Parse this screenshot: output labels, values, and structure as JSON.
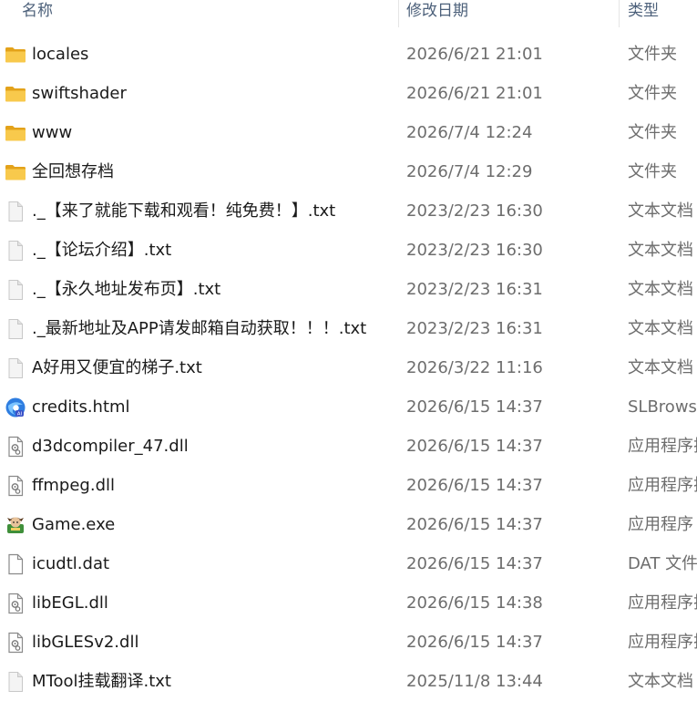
{
  "header": {
    "name": "名称",
    "date": "修改日期",
    "type": "类型"
  },
  "files": [
    {
      "name": "locales",
      "date": "2026/6/21 21:01",
      "type": "文件夹",
      "icon": "folder-icon"
    },
    {
      "name": "swiftshader",
      "date": "2026/6/21 21:01",
      "type": "文件夹",
      "icon": "folder-icon"
    },
    {
      "name": "www",
      "date": "2026/7/4 12:24",
      "type": "文件夹",
      "icon": "folder-icon"
    },
    {
      "name": "全回想存档",
      "date": "2026/7/4 12:29",
      "type": "文件夹",
      "icon": "folder-icon"
    },
    {
      "name": "._【来了就能下载和观看！纯免费！】.txt",
      "date": "2023/2/23 16:30",
      "type": "文本文档",
      "icon": "text-file-icon"
    },
    {
      "name": "._【论坛介绍】.txt",
      "date": "2023/2/23 16:30",
      "type": "文本文档",
      "icon": "text-file-icon"
    },
    {
      "name": "._【永久地址发布页】.txt",
      "date": "2023/2/23 16:31",
      "type": "文本文档",
      "icon": "text-file-icon"
    },
    {
      "name": "._最新地址及APP请发邮箱自动获取！！！.txt",
      "date": "2023/2/23 16:31",
      "type": "文本文档",
      "icon": "text-file-icon"
    },
    {
      "name": "A好用又便宜的梯子.txt",
      "date": "2026/3/22 11:16",
      "type": "文本文档",
      "icon": "text-file-icon"
    },
    {
      "name": "credits.html",
      "date": "2026/6/15 14:37",
      "type": "SLBrowser",
      "icon": "browser-html-icon"
    },
    {
      "name": "d3dcompiler_47.dll",
      "date": "2026/6/15 14:37",
      "type": "应用程序扩展",
      "icon": "dll-file-icon"
    },
    {
      "name": "ffmpeg.dll",
      "date": "2026/6/15 14:37",
      "type": "应用程序扩展",
      "icon": "dll-file-icon"
    },
    {
      "name": "Game.exe",
      "date": "2026/6/15 14:37",
      "type": "应用程序",
      "icon": "game-exe-icon"
    },
    {
      "name": "icudtl.dat",
      "date": "2026/6/15 14:37",
      "type": "DAT 文件",
      "icon": "blank-file-icon"
    },
    {
      "name": "libEGL.dll",
      "date": "2026/6/15 14:38",
      "type": "应用程序扩展",
      "icon": "dll-file-icon"
    },
    {
      "name": "libGLESv2.dll",
      "date": "2026/6/15 14:37",
      "type": "应用程序扩展",
      "icon": "dll-file-icon"
    },
    {
      "name": "MTool挂载翻译.txt",
      "date": "2025/11/8 13:44",
      "type": "文本文档",
      "icon": "text-file-icon"
    }
  ],
  "colors": {
    "folder": "#f2c14e",
    "header_text": "#4c607a",
    "meta_text": "#6d6d6d",
    "name_text": "#1a1a1a"
  }
}
